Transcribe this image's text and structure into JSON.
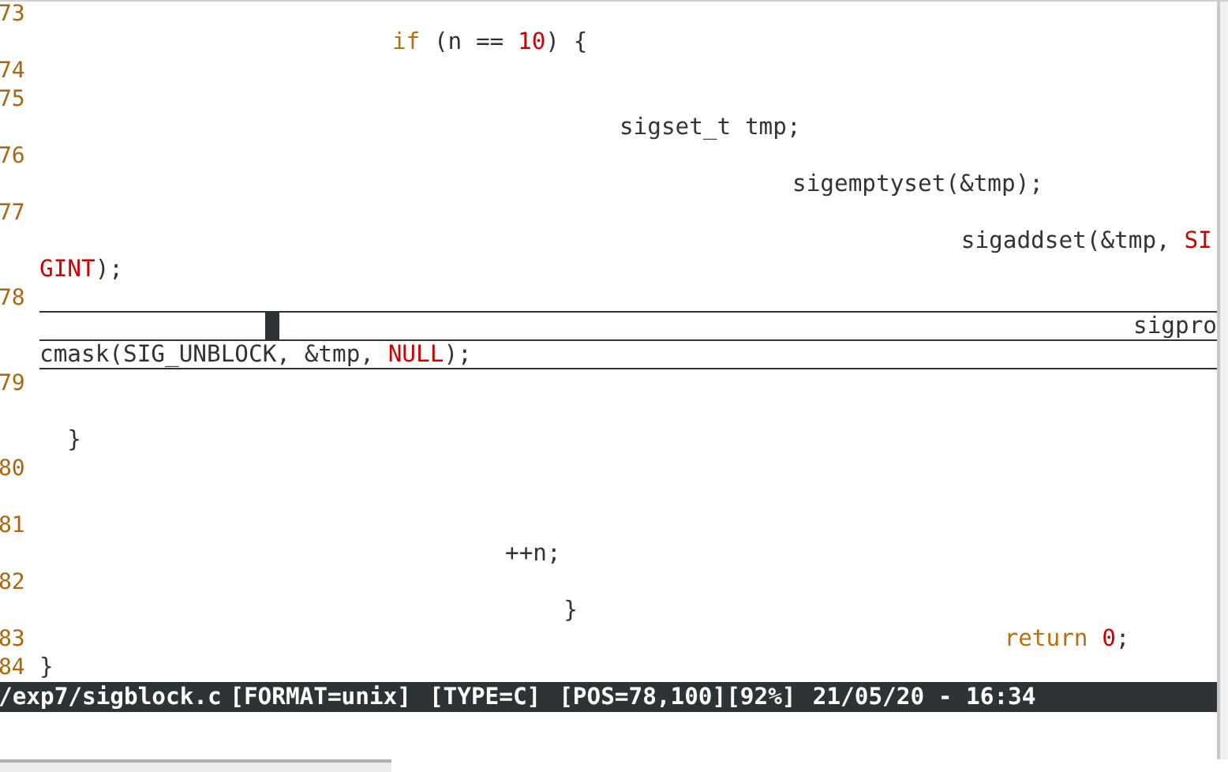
{
  "editor": {
    "rows": [
      {
        "kind": "number",
        "number": "73"
      },
      {
        "kind": "code",
        "tokens": [
          {
            "kind": "keyword",
            "text": "if"
          },
          {
            "kind": "plain",
            "text": " (n == "
          },
          {
            "kind": "constant",
            "text": "10"
          },
          {
            "kind": "plain",
            "text": ") {"
          }
        ]
      },
      {
        "kind": "number",
        "number": "74"
      },
      {
        "kind": "number",
        "number": "75"
      },
      {
        "kind": "code",
        "tokens": [
          {
            "kind": "plain",
            "text": "sigset_t tmp;"
          }
        ]
      },
      {
        "kind": "number",
        "number": "76"
      },
      {
        "kind": "code",
        "tokens": [
          {
            "kind": "plain",
            "text": "sigemptyset(&tmp);"
          }
        ]
      },
      {
        "kind": "number",
        "number": "77"
      },
      {
        "kind": "code",
        "tokens": [
          {
            "kind": "plain",
            "text": "sigaddset(&tmp, "
          },
          {
            "kind": "constant",
            "text": "SI"
          }
        ]
      },
      {
        "kind": "code",
        "tokens": [
          {
            "kind": "constant",
            "text": "GINT"
          },
          {
            "kind": "plain",
            "text": ");"
          }
        ]
      },
      {
        "kind": "number",
        "number": "78",
        "current": true
      },
      {
        "kind": "code",
        "current": true,
        "cursor": true,
        "tokens": [
          {
            "kind": "plain",
            "text": "sigpro"
          }
        ]
      },
      {
        "kind": "code",
        "current": true,
        "tokens": [
          {
            "kind": "plain",
            "text": "cmask(SIG_UNBLOCK, &tmp, "
          },
          {
            "kind": "constant",
            "text": "NULL"
          },
          {
            "kind": "plain",
            "text": ");"
          }
        ]
      },
      {
        "kind": "number",
        "number": "79"
      },
      {
        "kind": "blank"
      },
      {
        "kind": "code",
        "tokens": [
          {
            "kind": "plain",
            "text": "}"
          }
        ]
      },
      {
        "kind": "number",
        "number": "80"
      },
      {
        "kind": "blank"
      },
      {
        "kind": "number",
        "number": "81"
      },
      {
        "kind": "code",
        "tokens": [
          {
            "kind": "plain",
            "text": "++n;"
          }
        ]
      },
      {
        "kind": "number",
        "number": "82"
      },
      {
        "kind": "code",
        "tokens": [
          {
            "kind": "plain",
            "text": "}"
          }
        ]
      },
      {
        "kind": "number",
        "number": "83",
        "tokens": [
          {
            "kind": "keyword",
            "text": "return"
          },
          {
            "kind": "constant",
            "text": "0",
            "space_before": true
          },
          {
            "kind": "plain",
            "text": ";"
          }
        ]
      },
      {
        "kind": "number",
        "number": "84",
        "tokens": [
          {
            "kind": "plain",
            "text": "}"
          }
        ]
      }
    ]
  },
  "status_bar": {
    "segments": [
      "/exp7/sigblock.c",
      "[FORMAT=unix]",
      "[TYPE=C]",
      "[POS=78,100]",
      "[92%]",
      "21/05/20 - 16:34"
    ]
  }
}
